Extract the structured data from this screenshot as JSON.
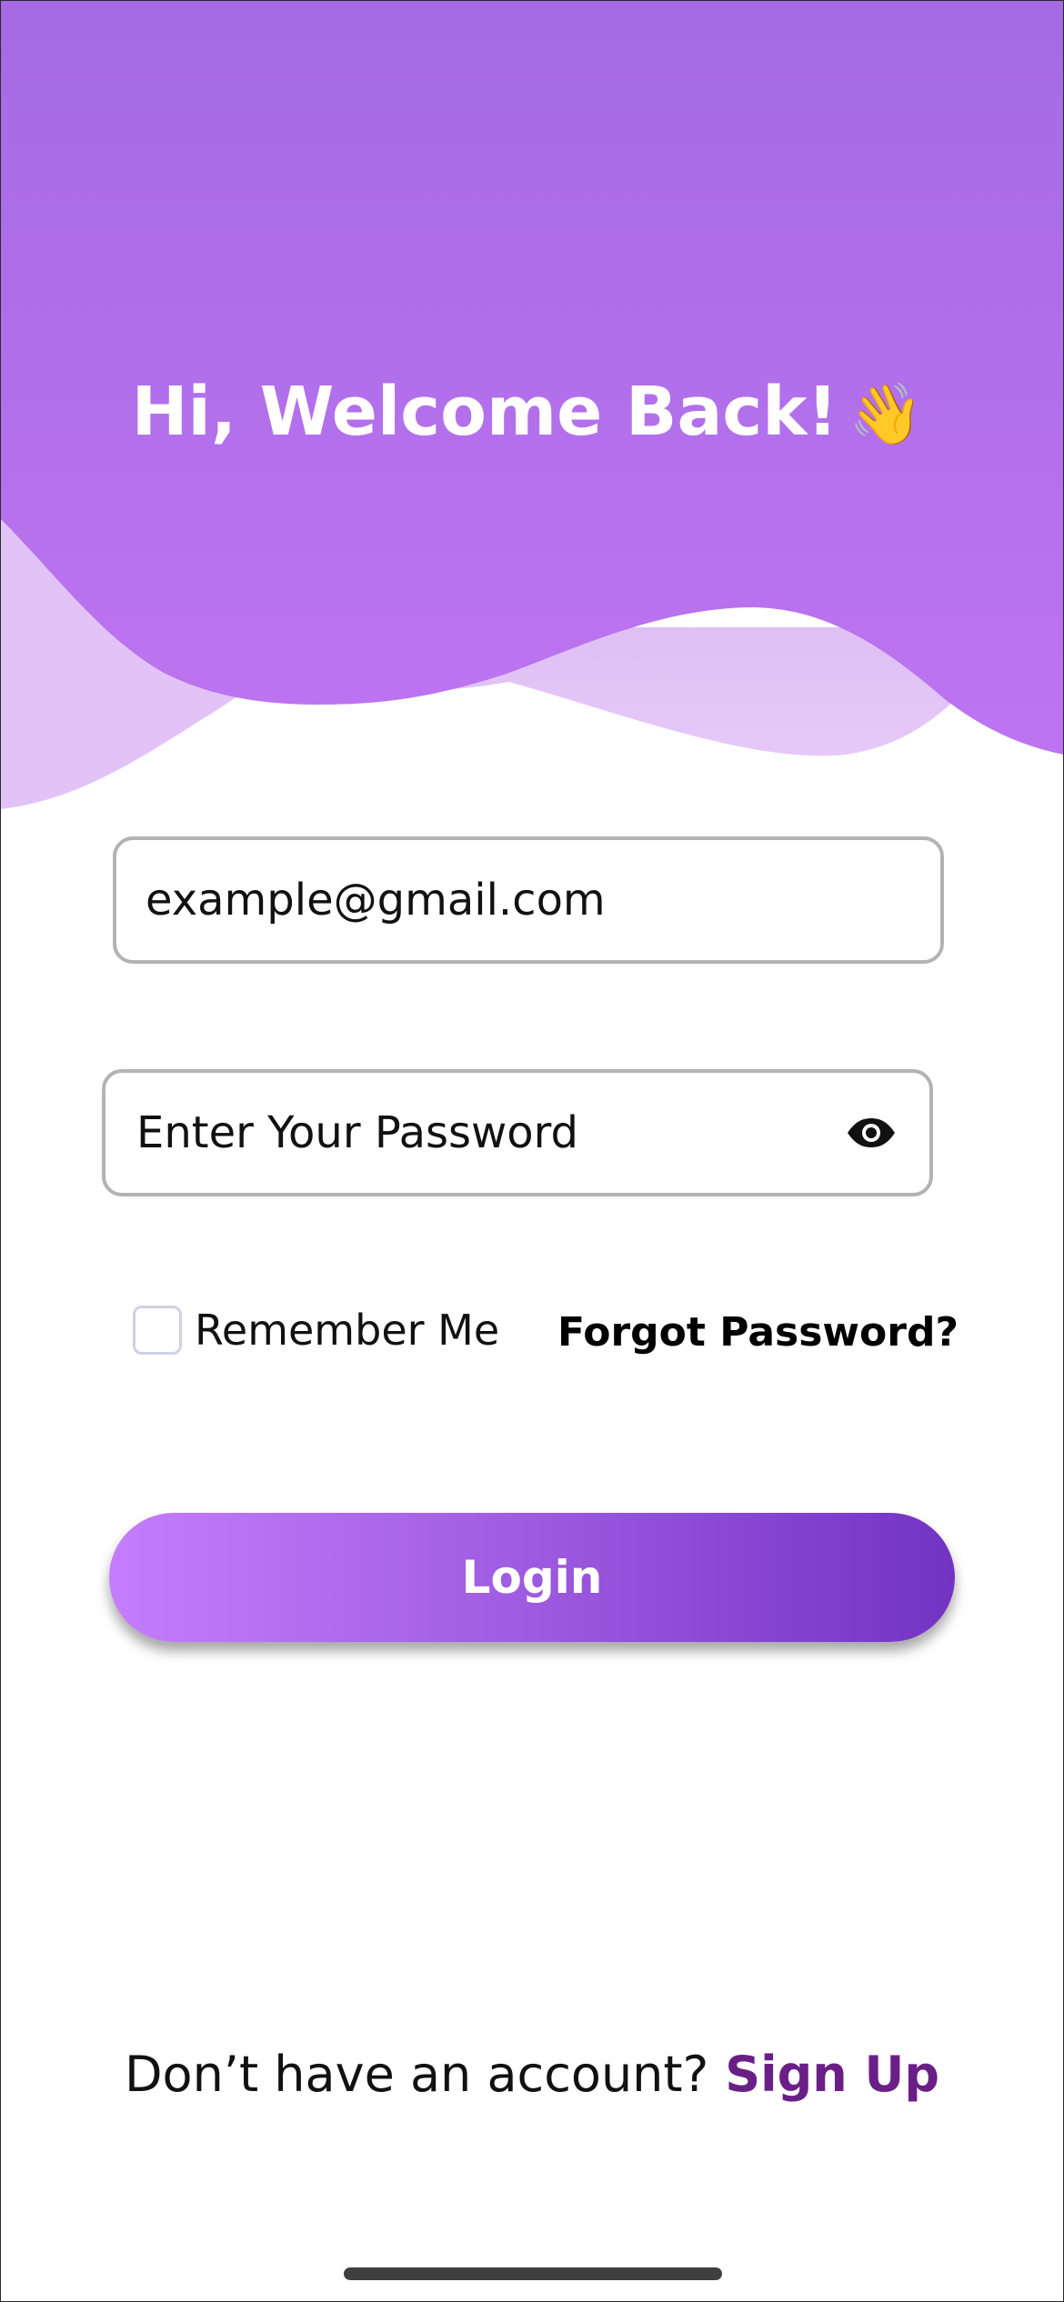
{
  "header": {
    "title": "Hi, Welcome Back!",
    "emoji": "👋",
    "colors": {
      "top": "#a56ae4",
      "bottom": "#bd73f0",
      "wave_light": "#dcbaf3",
      "wave_lighter": "#e3c4f7"
    }
  },
  "form": {
    "email": {
      "value": "example@gmail.com"
    },
    "password": {
      "placeholder": "Enter Your Password",
      "toggle_icon": "eye-icon"
    },
    "remember_label": "Remember Me",
    "forgot_label": "Forgot Password?",
    "login_label": "Login",
    "login_gradient": [
      "#c47dfd",
      "#a25ee3",
      "#7333c3"
    ]
  },
  "footer": {
    "prompt": "Don’t have an account?",
    "signup_label": "Sign Up",
    "signup_color": "#6a1f86"
  }
}
